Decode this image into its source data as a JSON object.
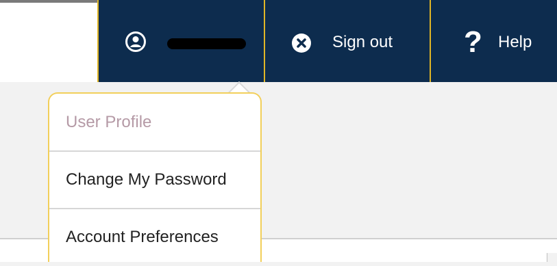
{
  "header": {
    "user": {
      "icon": "user-circle-icon",
      "name_redacted": ""
    },
    "signout": {
      "icon": "close-circle-icon",
      "label": "Sign out"
    },
    "help": {
      "icon": "question-mark-icon",
      "label": "Help"
    }
  },
  "dropdown": {
    "items": [
      {
        "label": "User Profile"
      },
      {
        "label": "Change My Password"
      },
      {
        "label": "Account Preferences"
      }
    ]
  },
  "colors": {
    "header_bg": "#0d2c4e",
    "separator": "#e0b626",
    "dropdown_border": "#f2cf5a",
    "muted_text": "#b59aa6",
    "page_bg": "#f2f2f2"
  }
}
